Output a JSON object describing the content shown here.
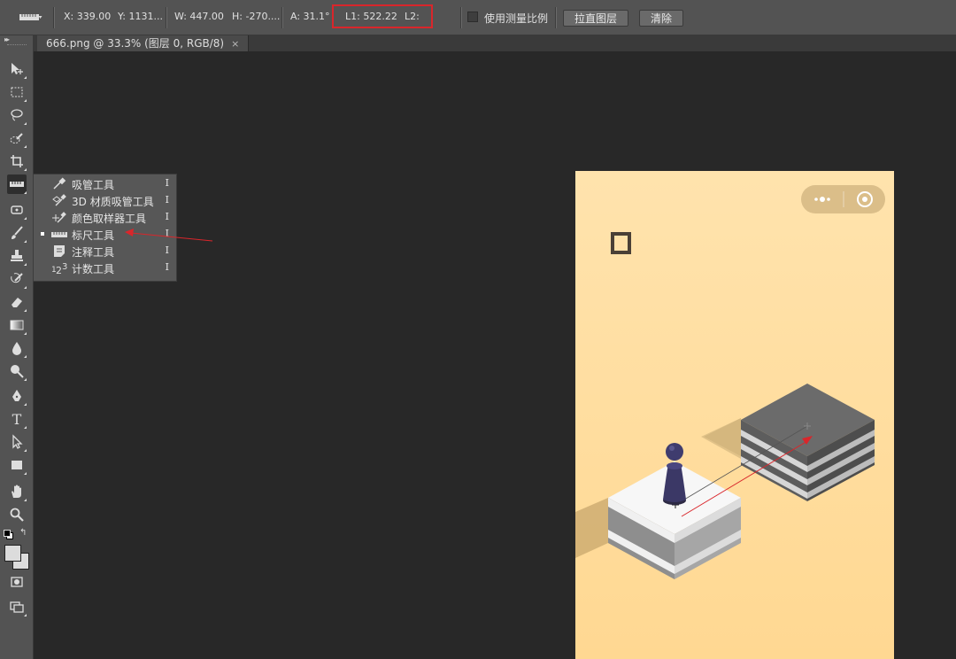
{
  "options_bar": {
    "x": "X: 339.00",
    "y": "Y: 1131...",
    "w": "W: 447.00",
    "h": "H: -270....",
    "a": "A: 31.1°",
    "l1": "L1: 522.22",
    "l2": "L2:",
    "use_scale_label": "使用测量比例",
    "straighten_label": "拉直图层",
    "clear_label": "清除",
    "highlight_color": "#d9262b"
  },
  "document_tab": {
    "title": "666.png @ 33.3% (图层 0, RGB/8)",
    "close": "×"
  },
  "flyout": {
    "items": [
      {
        "label": "吸管工具",
        "key": "I",
        "icon": "eyedropper-icon",
        "selected": false
      },
      {
        "label": "3D 材质吸管工具",
        "key": "I",
        "icon": "3d-material-eyedropper-icon",
        "selected": false
      },
      {
        "label": "颜色取样器工具",
        "key": "I",
        "icon": "color-sampler-icon",
        "selected": false
      },
      {
        "label": "标尺工具",
        "key": "I",
        "icon": "ruler-icon",
        "selected": true
      },
      {
        "label": "注释工具",
        "key": "I",
        "icon": "note-icon",
        "selected": false
      },
      {
        "label": "计数工具",
        "key": "I",
        "icon": "count-icon",
        "selected": false
      }
    ]
  },
  "colors": {
    "ui_panel": "#535353",
    "workspace": "#282828",
    "canvas_top": "#ffe3ad",
    "canvas_bottom": "#ffd892",
    "annotation": "#d9262b"
  }
}
